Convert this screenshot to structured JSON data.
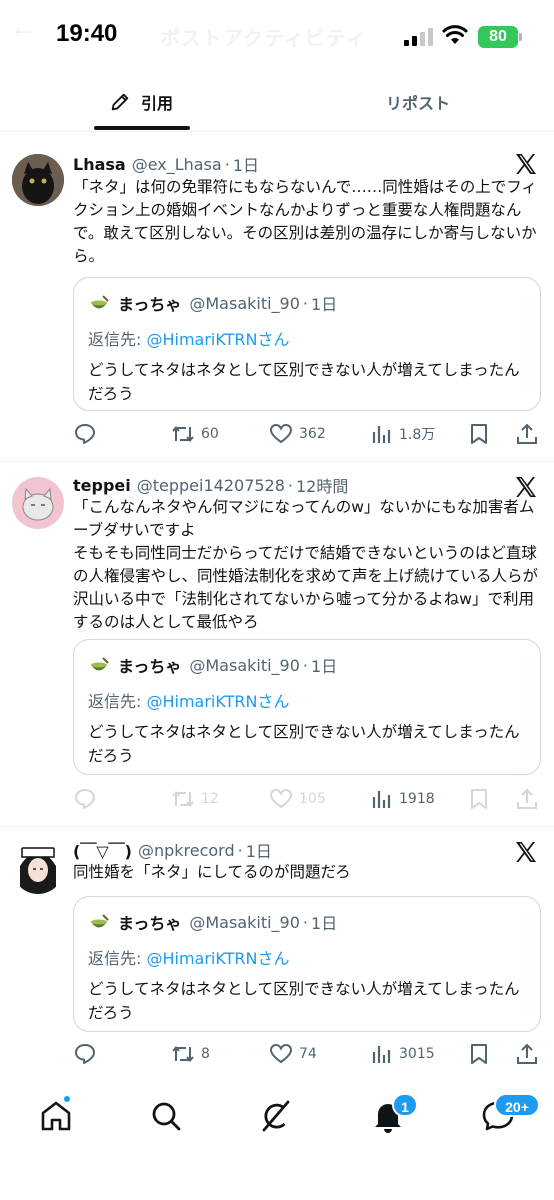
{
  "status_bar": {
    "time": "19:40",
    "battery": "80",
    "ghost_title": "ポストアクティビティ"
  },
  "tabs": [
    {
      "label": "引用",
      "icon": "quote-pen-icon",
      "active": true
    },
    {
      "label": "リポスト",
      "active": false
    }
  ],
  "colors": {
    "accent": "#1d9bf0",
    "text": "#0f1419",
    "muted": "#536471",
    "battery": "#34c759"
  },
  "posts": [
    {
      "name": "Lhasa",
      "handle": "@ex_Lhasa",
      "time": "1日",
      "text": "「ネタ」は何の免罪符にもならないんで……同性婚はその上でフィクション上の婚姻イベントなんかよりずっと重要な人権問題なんで。敢えて区別しない。その区別は差別の温存にしか寄与しないから。",
      "quote": {
        "name": "まっちゃ",
        "handle": "@Masakiti_90",
        "time": "1日",
        "reply_prefix": "返信先: ",
        "reply_to": "@HimariKTRNさん",
        "text": "どうしてネタはネタとして区別できない人が増えてしまったんだろう"
      },
      "actions": {
        "replies": "",
        "reposts": "60",
        "likes": "362",
        "views": "1.8万"
      }
    },
    {
      "name": "teppei",
      "handle": "@teppei14207528",
      "time": "12時間",
      "text": "「こんなんネタやん何マジになってんのw」ないかにもな加害者ムーブダサいですよ\nそもそも同性同士だからってだけで結婚できないというのはど直球の人権侵害やし、同性婚法制化を求めて声を上げ続けている人らが沢山いる中で「法制化されてないから嘘って分かるよねw」で利用するのは人として最低やろ",
      "quote": {
        "name": "まっちゃ",
        "handle": "@Masakiti_90",
        "time": "1日",
        "reply_prefix": "返信先: ",
        "reply_to": "@HimariKTRNさん",
        "text": "どうしてネタはネタとして区別できない人が増えてしまったんだろう"
      },
      "actions": {
        "replies": "",
        "reposts": "12",
        "likes": "105",
        "views": "1918"
      }
    },
    {
      "name": "(￣▽￣)",
      "handle": "@npkrecord",
      "time": "1日",
      "text": "同性婚を「ネタ」にしてるのが問題だろ",
      "quote": {
        "name": "まっちゃ",
        "handle": "@Masakiti_90",
        "time": "1日",
        "reply_prefix": "返信先: ",
        "reply_to": "@HimariKTRNさん",
        "text": "どうしてネタはネタとして区別できない人が増えてしまったんだろう"
      },
      "actions": {
        "replies": "",
        "reposts": "8",
        "likes": "74",
        "views": "3015"
      }
    }
  ],
  "bottom_nav": {
    "items": [
      "home-icon",
      "search-icon",
      "grok-icon",
      "notifications-icon",
      "messages-icon"
    ],
    "notifications_badge": "1",
    "messages_badge": "20+"
  }
}
